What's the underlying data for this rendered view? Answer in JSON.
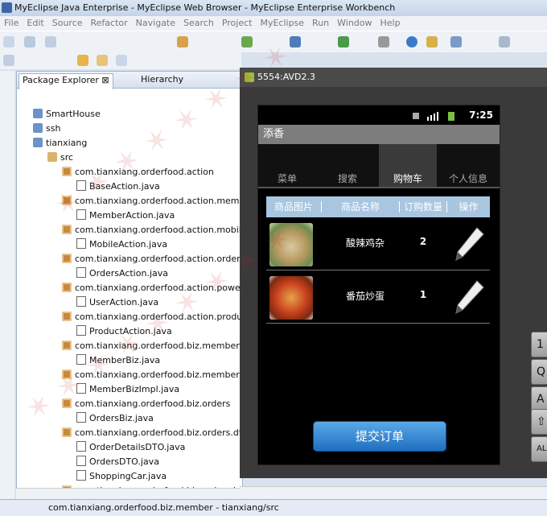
{
  "window": {
    "title": "MyEclipse Java Enterprise - MyEclipse Web Browser - MyEclipse Enterprise Workbench"
  },
  "menu": [
    "File",
    "Edit",
    "Source",
    "Refactor",
    "Navigate",
    "Search",
    "Project",
    "MyEclipse",
    "Run",
    "Window",
    "Help"
  ],
  "package_explorer": {
    "tab_label": "Package Explorer",
    "hierarchy_tab_label": "Hierarchy",
    "tree": [
      {
        "label": "SmartHouse",
        "icon": "project-icon",
        "indent": 1
      },
      {
        "label": "ssh",
        "icon": "project-icon",
        "indent": 1
      },
      {
        "label": "tianxiang",
        "icon": "project-icon",
        "indent": 1
      },
      {
        "label": "src",
        "icon": "source-folder-icon",
        "indent": 2
      },
      {
        "label": "com.tianxiang.orderfood.action",
        "icon": "package-icon",
        "indent": 3
      },
      {
        "label": "BaseAction.java",
        "icon": "java-file-icon",
        "indent": 4
      },
      {
        "label": "com.tianxiang.orderfood.action.member",
        "icon": "package-icon",
        "indent": 3
      },
      {
        "label": "MemberAction.java",
        "icon": "java-file-icon",
        "indent": 4
      },
      {
        "label": "com.tianxiang.orderfood.action.mobile",
        "icon": "package-icon",
        "indent": 3
      },
      {
        "label": "MobileAction.java",
        "icon": "java-file-icon",
        "indent": 4
      },
      {
        "label": "com.tianxiang.orderfood.action.orders",
        "icon": "package-icon",
        "indent": 3
      },
      {
        "label": "OrdersAction.java",
        "icon": "java-file-icon",
        "indent": 4
      },
      {
        "label": "com.tianxiang.orderfood.action.power",
        "icon": "package-icon",
        "indent": 3
      },
      {
        "label": "UserAction.java",
        "icon": "java-file-icon",
        "indent": 4
      },
      {
        "label": "com.tianxiang.orderfood.action.product",
        "icon": "package-icon",
        "indent": 3
      },
      {
        "label": "ProductAction.java",
        "icon": "java-file-icon",
        "indent": 4
      },
      {
        "label": "com.tianxiang.orderfood.biz.member",
        "icon": "package-icon",
        "indent": 3
      },
      {
        "label": "MemberBiz.java",
        "icon": "java-file-icon",
        "indent": 4
      },
      {
        "label": "com.tianxiang.orderfood.biz.member.im",
        "icon": "package-icon",
        "indent": 3
      },
      {
        "label": "MemberBizImpl.java",
        "icon": "java-file-icon",
        "indent": 4
      },
      {
        "label": "com.tianxiang.orderfood.biz.orders",
        "icon": "package-icon",
        "indent": 3
      },
      {
        "label": "OrdersBiz.java",
        "icon": "java-file-icon",
        "indent": 4
      },
      {
        "label": "com.tianxiang.orderfood.biz.orders.dto",
        "icon": "package-icon",
        "indent": 3
      },
      {
        "label": "OrderDetailsDTO.java",
        "icon": "java-file-icon",
        "indent": 4
      },
      {
        "label": "OrdersDTO.java",
        "icon": "java-file-icon",
        "indent": 4
      },
      {
        "label": "ShoppingCar.java",
        "icon": "java-file-icon",
        "indent": 4
      },
      {
        "label": "com.tianxiang.orderfood.biz.orders.imp",
        "icon": "package-icon",
        "indent": 3
      }
    ]
  },
  "status_bar": {
    "text": "com.tianxiang.orderfood.biz.member - tianxiang/src"
  },
  "emulator": {
    "title": "5554:AVD2.3",
    "clock": "7:25",
    "app_title": "添香",
    "tabs": [
      "菜单",
      "搜索",
      "购物车",
      "个人信息"
    ],
    "selected_tab": "购物车",
    "columns": [
      "商品图片",
      "商品名称",
      "订购数量",
      "操作"
    ],
    "rows": [
      {
        "name": "酸辣鸡杂",
        "quantity": "2"
      },
      {
        "name": "番茄炒蛋",
        "quantity": "1"
      }
    ],
    "submit_label": "提交订单"
  },
  "keyboard_keys": [
    "1",
    "Q",
    "A",
    "",
    "AL"
  ],
  "colors": {
    "table_header": "#a8c6e0",
    "submit_button": "#2a7fd4",
    "selected_tab": "#3a3a3a"
  }
}
